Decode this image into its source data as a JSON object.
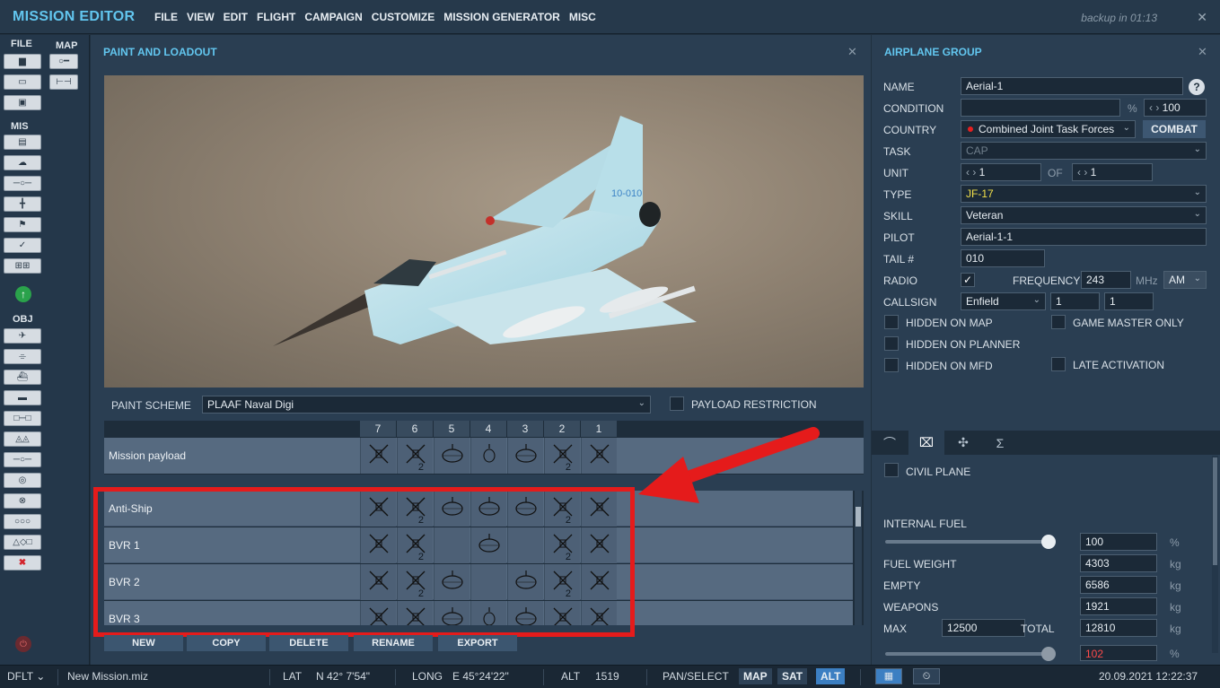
{
  "app": {
    "title": "MISSION EDITOR",
    "menu": [
      "FILE",
      "VIEW",
      "EDIT",
      "FLIGHT",
      "CAMPAIGN",
      "CUSTOMIZE",
      "MISSION GENERATOR",
      "MISC"
    ],
    "backup": "backup in 01:13",
    "close": "✕"
  },
  "leftbar": {
    "file_label": "FILE",
    "map_label": "MAP",
    "mis_label": "MIS",
    "obj_label": "OBJ",
    "file_buttons": [
      "new-icon",
      "open-icon",
      "save-icon"
    ],
    "map_buttons": [
      "ruler-icon",
      "measure-icon"
    ],
    "mis_buttons": [
      "briefing-icon",
      "weather-icon",
      "triggers-icon",
      "target-icon",
      "flag-icon",
      "check-icon",
      "group-icon"
    ],
    "obj_buttons": [
      "plane-icon",
      "helicopter-icon",
      "ship-icon",
      "vehicle-icon",
      "static-icon",
      "zone-icon",
      "nav-icon",
      "target-circle-icon",
      "cross-circle-icon",
      "links-icon",
      "shapes-icon",
      "delete-icon"
    ]
  },
  "paint_loadout": {
    "title": "PAINT AND LOADOUT",
    "paint_scheme_label": "PAINT SCHEME",
    "paint_scheme_value": "PLAAF Naval Digi",
    "payload_restriction_label": "PAYLOAD RESTRICTION",
    "pylons": [
      "7",
      "6",
      "5",
      "4",
      "3",
      "2",
      "1"
    ],
    "mission_payload": {
      "label": "Mission payload",
      "cells": [
        {
          "icon": "x-weapon-icon",
          "count": ""
        },
        {
          "icon": "x-weapon-icon",
          "count": "2"
        },
        {
          "icon": "tank-icon",
          "count": ""
        },
        {
          "icon": "pod-icon",
          "count": ""
        },
        {
          "icon": "tank-icon",
          "count": ""
        },
        {
          "icon": "x-weapon-icon",
          "count": "2"
        },
        {
          "icon": "x-weapon-icon",
          "count": ""
        }
      ]
    },
    "presets": [
      {
        "label": "Anti-Ship",
        "cells": [
          {
            "icon": "x-weapon-icon",
            "count": ""
          },
          {
            "icon": "x-weapon-icon",
            "count": "2"
          },
          {
            "icon": "tank-icon",
            "count": ""
          },
          {
            "icon": "tank-icon",
            "count": ""
          },
          {
            "icon": "tank-icon",
            "count": ""
          },
          {
            "icon": "x-weapon-icon",
            "count": "2"
          },
          {
            "icon": "x-weapon-icon",
            "count": ""
          }
        ]
      },
      {
        "label": "BVR 1",
        "cells": [
          {
            "icon": "x-weapon-icon",
            "count": ""
          },
          {
            "icon": "x-weapon-icon",
            "count": "2"
          },
          {
            "icon": "",
            "count": ""
          },
          {
            "icon": "tank-icon",
            "count": ""
          },
          {
            "icon": "",
            "count": ""
          },
          {
            "icon": "x-weapon-icon",
            "count": "2"
          },
          {
            "icon": "x-weapon-icon",
            "count": ""
          }
        ]
      },
      {
        "label": "BVR 2",
        "cells": [
          {
            "icon": "x-weapon-icon",
            "count": ""
          },
          {
            "icon": "x-weapon-icon",
            "count": "2"
          },
          {
            "icon": "tank-icon",
            "count": ""
          },
          {
            "icon": "",
            "count": ""
          },
          {
            "icon": "tank-icon",
            "count": ""
          },
          {
            "icon": "x-weapon-icon",
            "count": "2"
          },
          {
            "icon": "x-weapon-icon",
            "count": ""
          }
        ]
      },
      {
        "label": "BVR 3",
        "cells": [
          {
            "icon": "x-weapon-icon",
            "count": ""
          },
          {
            "icon": "x-weapon-icon",
            "count": ""
          },
          {
            "icon": "tank-icon",
            "count": ""
          },
          {
            "icon": "pod-icon",
            "count": ""
          },
          {
            "icon": "tank-icon",
            "count": ""
          },
          {
            "icon": "x-weapon-icon",
            "count": ""
          },
          {
            "icon": "x-weapon-icon",
            "count": ""
          }
        ]
      }
    ],
    "buttons": [
      "NEW",
      "COPY",
      "DELETE",
      "RENAME",
      "EXPORT"
    ],
    "tail_number_on_aircraft": "10-010"
  },
  "airplane_group": {
    "title": "AIRPLANE GROUP",
    "name_label": "NAME",
    "name_value": "Aerial-1",
    "help": "?",
    "condition_label": "CONDITION",
    "condition_unit": "%",
    "condition_value": "100",
    "country_label": "COUNTRY",
    "country_value": "Combined Joint Task Forces",
    "combat_button": "COMBAT",
    "task_label": "TASK",
    "task_value": "CAP",
    "unit_label": "UNIT",
    "unit_value": "1",
    "of_label": "OF",
    "of_value": "1",
    "type_label": "TYPE",
    "type_value": "JF-17",
    "skill_label": "SKILL",
    "skill_value": "Veteran",
    "pilot_label": "PILOT",
    "pilot_value": "Aerial-1-1",
    "tail_label": "TAIL #",
    "tail_value": "010",
    "radio_label": "RADIO",
    "frequency_label": "FREQUENCY",
    "frequency_value": "243",
    "frequency_unit": "MHz",
    "modulation": "AM",
    "callsign_label": "CALLSIGN",
    "callsign_value": "Enfield",
    "callsign_n1": "1",
    "callsign_n2": "1",
    "hidden_on_map": "HIDDEN ON MAP",
    "game_master_only": "GAME MASTER ONLY",
    "hidden_on_planner": "HIDDEN ON PLANNER",
    "hidden_on_mfd": "HIDDEN ON MFD",
    "late_activation": "LATE ACTIVATION",
    "tabs": [
      "route-icon",
      "payload-icon",
      "drone-icon",
      "summary-icon"
    ],
    "tab_glyphs": [
      "⌒",
      "⌧",
      "✣",
      "Σ"
    ],
    "civil_plane": "CIVIL PLANE",
    "internal_fuel_label": "INTERNAL FUEL",
    "internal_fuel_value": "100",
    "internal_fuel_percent": 100,
    "fuel_weight_label": "FUEL WEIGHT",
    "fuel_weight_value": "4303",
    "empty_label": "EMPTY",
    "empty_value": "6586",
    "weapons_label": "WEAPONS",
    "weapons_value": "1921",
    "max_label": "MAX",
    "max_value": "12500",
    "total_label": "TOTAL",
    "total_value": "12810",
    "load_value": "102",
    "load_percent": 100,
    "kg": "kg",
    "pct": "%"
  },
  "statusbar": {
    "profile": "DFLT ⌄",
    "file": "New Mission.miz",
    "lat_label": "LAT",
    "lat_value": "N 42° 7'54\"",
    "long_label": "LONG",
    "long_value": "E 45°24'22\"",
    "alt_label": "ALT",
    "alt_value": "1519",
    "mode": "PAN/SELECT",
    "map_btn": "MAP",
    "sat_btn": "SAT",
    "alt_btn": "ALT",
    "datetime": "20.09.2021 12:22:37"
  },
  "colors": {
    "accent": "#62c6ef",
    "highlight_box": "#e51b1b",
    "active_toggle": "#3c7fc2"
  }
}
